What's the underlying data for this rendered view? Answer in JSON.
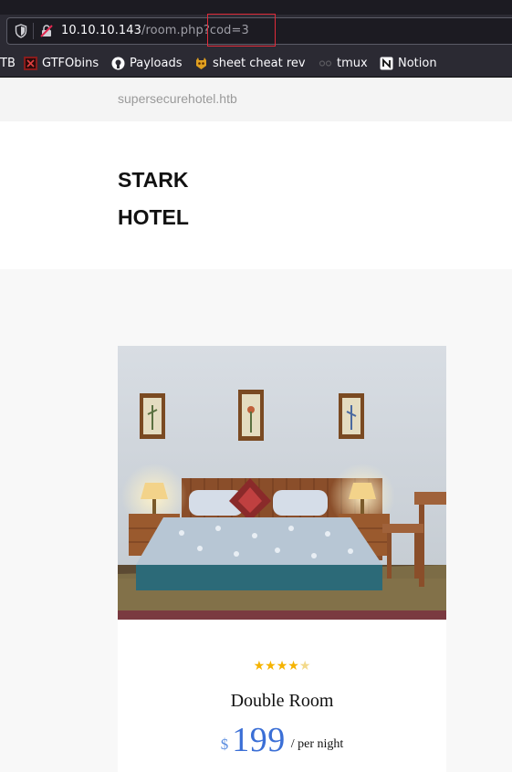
{
  "browser": {
    "url_host": "10.10.10.143",
    "url_path": "/room.php?cod=3"
  },
  "bookmarks": [
    {
      "label": "TB",
      "icon": "htb-icon"
    },
    {
      "label": "GTFObins",
      "icon": "gtfobins-icon"
    },
    {
      "label": "Payloads",
      "icon": "github-icon"
    },
    {
      "label": "sheet cheat rev",
      "icon": "skull-icon"
    },
    {
      "label": "tmux",
      "icon": "tmux-icon"
    },
    {
      "label": "Notion",
      "icon": "notion-icon"
    }
  ],
  "site": {
    "domain": "supersecurehotel.htb",
    "brand_line1": "STARK",
    "brand_line2": "HOTEL"
  },
  "room": {
    "rating": 4,
    "rating_max": 5,
    "name": "Double Room",
    "currency": "$",
    "price": "199",
    "per_night": "/ per night"
  },
  "colors": {
    "star": "#f5b300",
    "price": "#3b6fd6",
    "highlight": "#e02b3a"
  }
}
